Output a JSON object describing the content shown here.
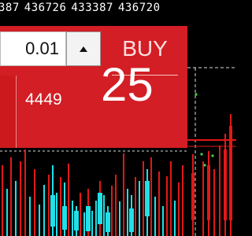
{
  "top_prices": [
    "387",
    "436726",
    "433387",
    "436720"
  ],
  "trade_panel": {
    "lot_value": "0.01",
    "buy_label": "BUY",
    "buy_price_small": "4449",
    "buy_price_big": "25"
  },
  "colors": {
    "panel_red": "#d21e24",
    "candle_up": "#20e0e8",
    "candle_down": "#e21818",
    "grid": "#dcdcdc",
    "marker": "#4ad04a"
  }
}
